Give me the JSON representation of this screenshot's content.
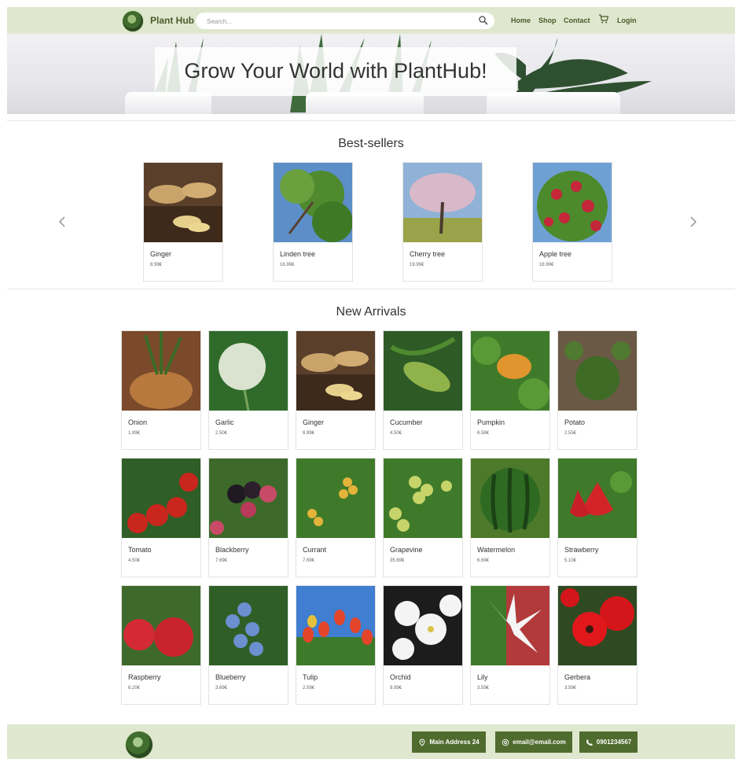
{
  "nav": {
    "brand": "Plant Hub",
    "search_placeholder": "Search...",
    "links": [
      "Home",
      "Shop",
      "Contact"
    ],
    "login": "Login"
  },
  "hero": {
    "title": "Grow Your World with PlantHub!"
  },
  "bestsellers": {
    "title": "Best-sellers",
    "items": [
      {
        "name": "Ginger",
        "price": "8.99€"
      },
      {
        "name": "Linden tree",
        "price": "16.99€"
      },
      {
        "name": "Cherry tree",
        "price": "19.99€"
      },
      {
        "name": "Apple tree",
        "price": "18.99€"
      }
    ]
  },
  "new_arrivals": {
    "title": "New Arrivals",
    "items": [
      {
        "name": "Onion",
        "price": "1.99€"
      },
      {
        "name": "Garlic",
        "price": "2.50€"
      },
      {
        "name": "Ginger",
        "price": "8.99€"
      },
      {
        "name": "Cucumber",
        "price": "4.50€"
      },
      {
        "name": "Pumpkin",
        "price": "6.58€"
      },
      {
        "name": "Potato",
        "price": "2.55€"
      },
      {
        "name": "Tomato",
        "price": "4.50€"
      },
      {
        "name": "Blackberry",
        "price": "7.69€"
      },
      {
        "name": "Currant",
        "price": "7.69€"
      },
      {
        "name": "Grapevine",
        "price": "35.69€"
      },
      {
        "name": "Watermelon",
        "price": "6.69€"
      },
      {
        "name": "Strawberry",
        "price": "5.10€"
      },
      {
        "name": "Raspberry",
        "price": "6.20€"
      },
      {
        "name": "Blueberry",
        "price": "3.69€"
      },
      {
        "name": "Tulip",
        "price": "2.59€"
      },
      {
        "name": "Orchid",
        "price": "9.99€"
      },
      {
        "name": "Lily",
        "price": "3.59€"
      },
      {
        "name": "Gerbera",
        "price": "3.59€"
      }
    ]
  },
  "footer": {
    "address": "Main Address 24",
    "email": "email@email.com",
    "phone": "0901234567"
  },
  "colors": {
    "nav_bg": "#dfe8cf",
    "accent": "#4f6b2e",
    "brand_text": "#4a5a2a"
  }
}
